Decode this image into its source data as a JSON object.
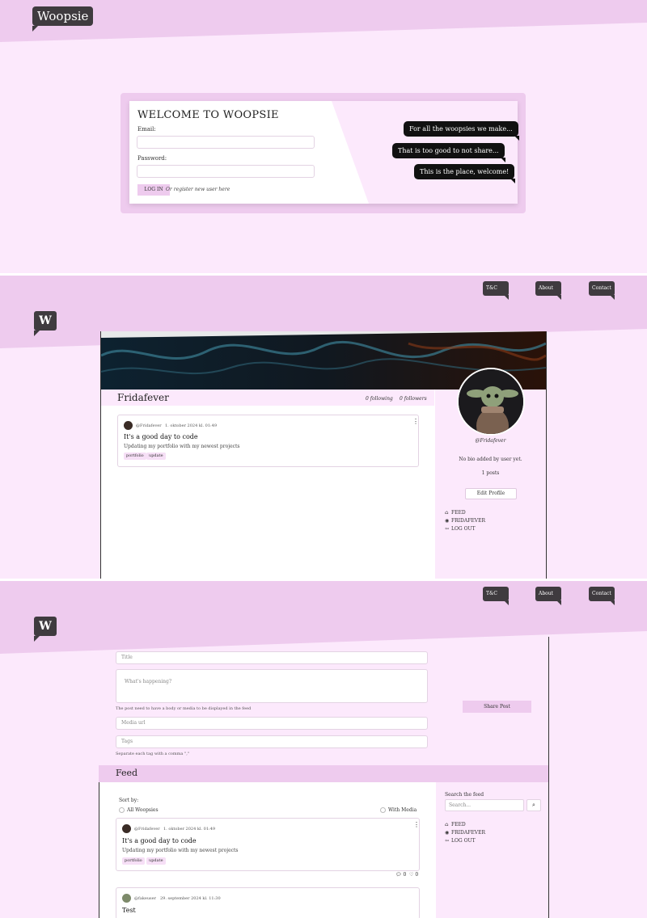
{
  "brand": {
    "logo": "Woopsie",
    "logo_short": "W"
  },
  "login": {
    "title": "WELCOME TO WOOPSIE",
    "email_label": "Email:",
    "password_label": "Password:",
    "login_button": "LOG IN",
    "register_link": "Or register new user here",
    "chat_bubbles": [
      "For all the woopsies we make...",
      "That is too good to not share...",
      "This is the place, welcome!"
    ]
  },
  "nav": {
    "items": [
      "T&C",
      "About",
      "Contact"
    ]
  },
  "profile": {
    "name": "Fridafever",
    "following": "0 following",
    "followers": "0 followers",
    "handle": "@Fridafever",
    "bio": "No bio added by user yet.",
    "posts_count": "1 posts",
    "edit_button": "Edit Profile",
    "menu": [
      "FEED",
      "FRIDAFEVER",
      "LOG OUT"
    ]
  },
  "post1": {
    "author": "@Fridafever",
    "date": "1. oktober 2024 kl. 01:49",
    "title": "It's a good day to code",
    "body": "Updating my portfolio with my newest projects",
    "tags": [
      "portfolio",
      "update"
    ],
    "comments": "0",
    "likes": "0"
  },
  "post2": {
    "author": "@fakeuser",
    "date": "29. september 2024 kl. 11:30",
    "title": "Test"
  },
  "composer": {
    "title_placeholder": "Title",
    "body_placeholder": "What's happening?",
    "body_hint": "The post need to have a body or media to be displayed in the feed",
    "media_placeholder": "Media url",
    "tags_placeholder": "Tags",
    "tags_hint": "Separate each tag with a comma \",\"",
    "share_button": "Share Post"
  },
  "feed": {
    "title": "Feed",
    "sort_label": "Sort by:",
    "sort_all": "All Woopsies",
    "sort_media": "With Media",
    "search_label": "Search the feed",
    "search_placeholder": "Search...",
    "menu": [
      "FEED",
      "FRIDAFEVER",
      "LOG OUT"
    ]
  }
}
